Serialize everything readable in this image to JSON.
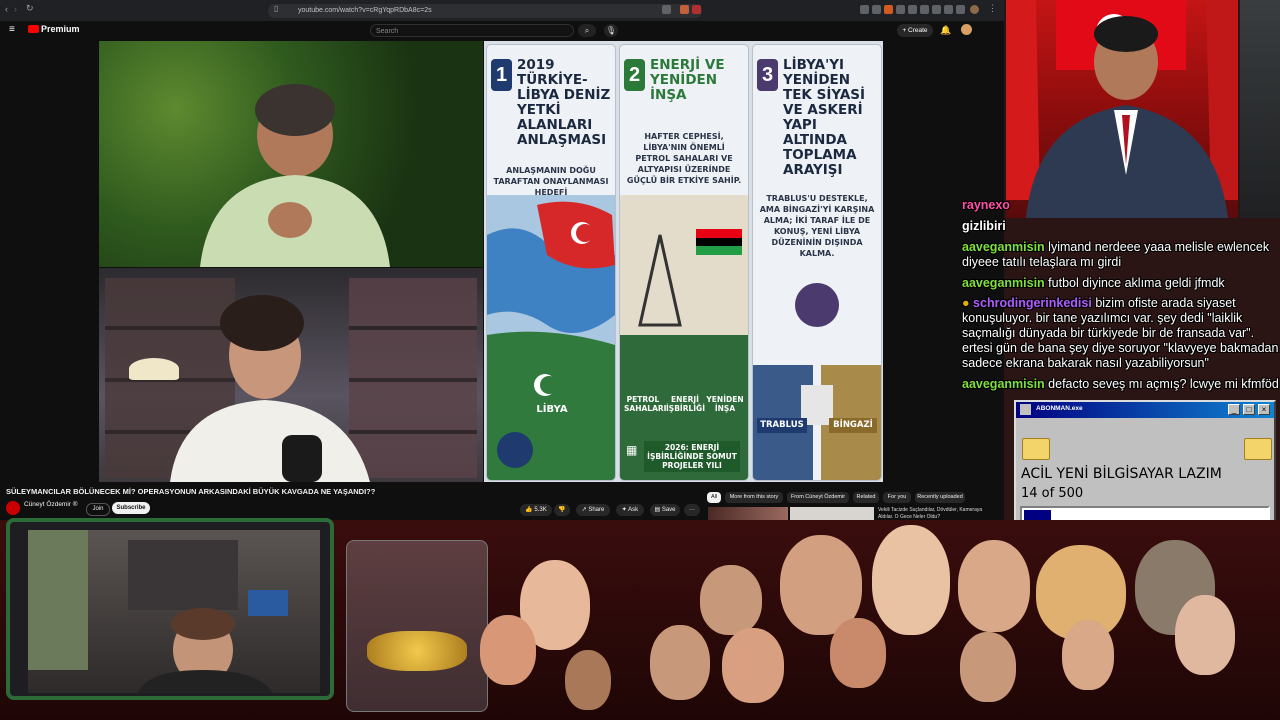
{
  "browser": {
    "url": "youtube.com/watch?v=cRgYqpRDbA8c=2s"
  },
  "youtube": {
    "logo_text": "Premium",
    "search_placeholder": "Search",
    "create_label": "+ Create",
    "video_title": "SÜLEYMANCILAR BÖLÜNECEK Mİ? OPERASYONUN ARKASINDAKİ BÜYÜK KAVGADA NE YAŞANDI??",
    "channel_name": "Cüneyt Özdemir ®",
    "join_label": "Join",
    "subscribe_label": "Subscribe",
    "likes": "5.3K",
    "share_label": "Share",
    "ask_label": "Ask",
    "save_label": "Save",
    "more_label": "···",
    "chips": [
      "All",
      "More from this story",
      "From Cüneyt Özdemir",
      "Related",
      "For you",
      "Recently uploaded"
    ],
    "related_title": "Vekili Tacizde Suçlandılar, Dövdüler, Kameraya Aldılar. O Gece Neler Oldu?"
  },
  "infographic": {
    "panels": [
      {
        "number": "1",
        "title": "2019 TÜRKİYE-LİBYA DENİZ YETKİ ALANLARI ANLAŞMASI",
        "subtitle": "ANLAŞMANIN DOĞU TARAFTAN ONAYLANMASI HEDEFİ",
        "label": "LİBYA"
      },
      {
        "number": "2",
        "title": "ENERJİ VE YENİDEN İNŞA",
        "subtitle": "HAFTER CEPHESİ, LİBYA'NIN ÖNEMLİ PETROL SAHALARI VE ALTYAPISI ÜZERİNDE GÜÇLÜ BİR ETKİYE SAHİP.",
        "icons": [
          "PETROL SAHALARI",
          "ENERJİ İŞBİRLİĞİ",
          "YENİDEN İNŞA"
        ],
        "footer": "2026: ENERJİ İŞBİRLİĞİNDE SOMUT PROJELER YILI"
      },
      {
        "number": "3",
        "title": "LİBYA'YI YENİDEN TEK SİYASİ VE ASKERİ YAPI ALTINDA TOPLAMA ARAYIŞI",
        "subtitle": "TRABLUS'U DESTEKLE, AMA BİNGAZİ'Yİ KARŞINA ALMA; İKİ TARAF İLE DE KONUŞ, YENİ LİBYA DÜZENİNİN DIŞINDA KALMA.",
        "left_city": "TRABLUS",
        "right_city": "BİNGAZİ"
      }
    ]
  },
  "chat": {
    "messages": [
      {
        "user": "raynexo",
        "text": "",
        "color": "pink"
      },
      {
        "user": "gizlibiri",
        "text": "",
        "color": "white"
      },
      {
        "user": "aaveganmisin",
        "text": "lyimand nerdeee yaaa melisle ewlencek diyeee tatılı telaşlara mı girdi",
        "color": "green"
      },
      {
        "user": "aaveganmisin",
        "text": "futbol diyince aklıma geldi jfmdk",
        "color": "green"
      },
      {
        "user": "schrodingerinkedisi",
        "text": "bizim ofiste arada siyaset konuşuluyor. bir tane yazılımcı var. şey dedi \"laiklik saçmalığı dünyada bir türkiyede bir de fransada var\". ertesi gün de bana şey diye soruyor \"klavyeye bakmadan sadece ekrana bakarak nasıl yazabiliyorsun\"",
        "color": "purple"
      },
      {
        "user": "aaveganmisin",
        "text": "defacto seveş mı açmış? lcwye mi kfmföd",
        "color": "green"
      }
    ]
  },
  "dialog": {
    "title": "ABONMAN.exe",
    "message": "ACİL YENİ BİLGİSAYAR LAZIM",
    "progress_text": "14 of 500",
    "progress_fraction": 0.028
  }
}
